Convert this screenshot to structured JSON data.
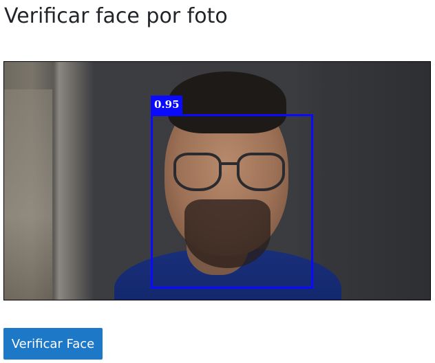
{
  "page": {
    "title": "Verificar face por foto"
  },
  "photo": {
    "detection": {
      "score_label": "0.95",
      "box_color": "#0a0aff"
    }
  },
  "actions": {
    "verify_label": "Verificar Face",
    "verify_color": "#1e78c8"
  }
}
